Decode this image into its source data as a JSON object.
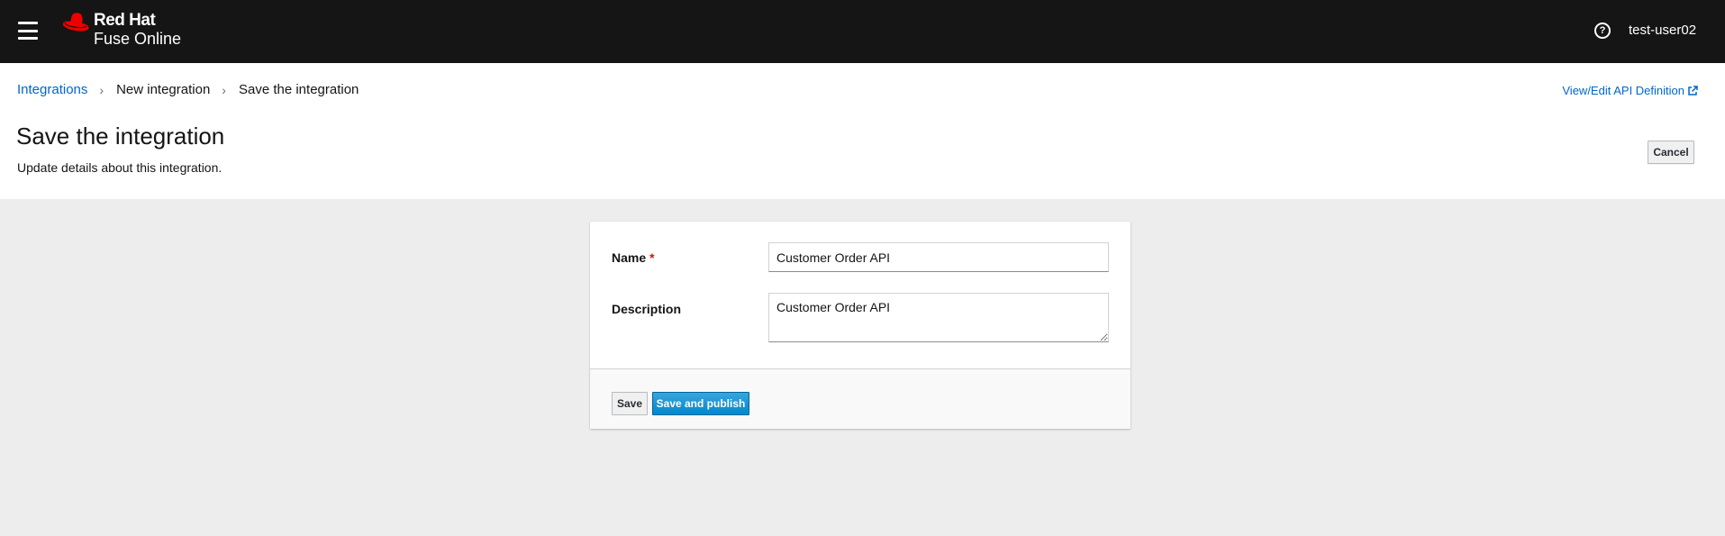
{
  "masthead": {
    "brand_line1": "Red Hat",
    "brand_line2": "Fuse Online",
    "user_name": "test-user02",
    "menu_icon": "hamburger-menu-icon",
    "help_icon": "question-circle-icon",
    "background_color": "#151515"
  },
  "breadcrumb": {
    "items": [
      {
        "label": "Integrations",
        "link": true
      },
      {
        "label": "New integration",
        "link": false
      },
      {
        "label": "Save the integration",
        "link": false
      }
    ]
  },
  "header": {
    "api_link_label": "View/Edit API Definition",
    "title": "Save the integration",
    "description": "Update details about this integration.",
    "cancel_label": "Cancel"
  },
  "form": {
    "name_label": "Name",
    "required_marker": "*",
    "name_value": "Customer Order API",
    "description_label": "Description",
    "description_value": "Customer Order API",
    "save_label": "Save",
    "publish_label": "Save and publish"
  },
  "colors": {
    "link": "#0066cc",
    "primary_button": "#0088ce",
    "required": "#c9190b",
    "brand_red": "#ee0000"
  }
}
